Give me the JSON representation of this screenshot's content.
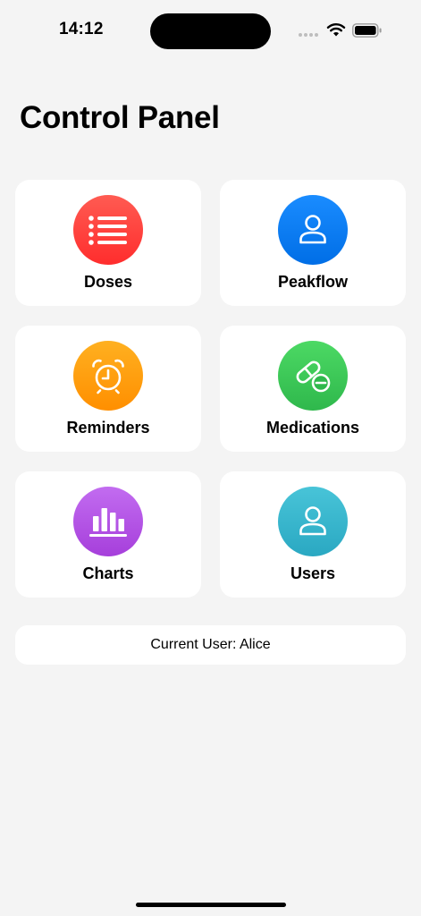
{
  "status_bar": {
    "time": "14:12"
  },
  "page": {
    "title": "Control Panel"
  },
  "tiles": [
    {
      "label": "Doses",
      "icon": "list-icon",
      "color": "#ff3b30"
    },
    {
      "label": "Peakflow",
      "icon": "person-icon",
      "color": "#007aff"
    },
    {
      "label": "Reminders",
      "icon": "alarm-clock-icon",
      "color": "#ff9500"
    },
    {
      "label": "Medications",
      "icon": "pills-icon",
      "color": "#34c759"
    },
    {
      "label": "Charts",
      "icon": "bar-chart-icon",
      "color": "#af52de"
    },
    {
      "label": "Users",
      "icon": "person-icon",
      "color": "#30b0c7"
    }
  ],
  "footer": {
    "current_user": "Current User: Alice"
  }
}
